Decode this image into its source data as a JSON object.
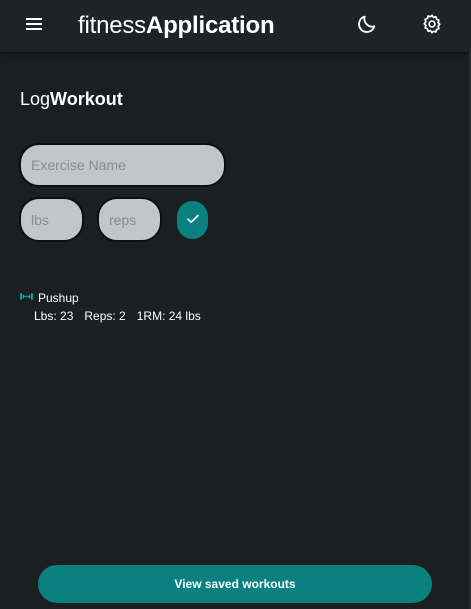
{
  "header": {
    "title_light": "fitness",
    "title_bold": "Application",
    "icons": {
      "menu": "hamburger-menu-icon",
      "theme": "moon-icon",
      "settings": "gear-icon"
    }
  },
  "log_section": {
    "title_light": "Log",
    "title_bold": "Workout"
  },
  "form": {
    "exercise_placeholder": "Exercise Name",
    "exercise_value": "",
    "lbs_placeholder": "lbs",
    "lbs_value": "",
    "reps_placeholder": "reps",
    "reps_value": "",
    "submit_icon": "checkmark-icon"
  },
  "workouts": [
    {
      "name": "Pushup",
      "icon": "dumbbell-icon",
      "lbs": "Lbs: 23",
      "reps": "Reps: 2",
      "one_rm": "1RM: 24 lbs"
    }
  ],
  "footer": {
    "view_saved_label": "View saved workouts"
  },
  "colors": {
    "background": "#1c1f22",
    "appbar": "#202326",
    "accent": "#0b8080",
    "field_bg": "#c4c5c7",
    "text": "#ffffff"
  }
}
